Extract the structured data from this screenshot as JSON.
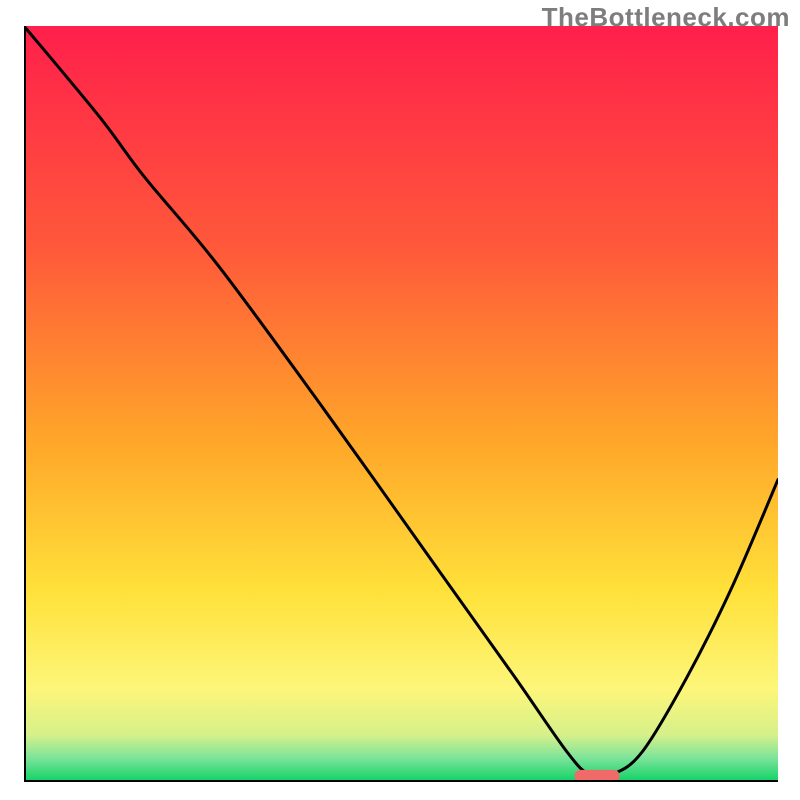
{
  "watermark": "TheBottleneck.com",
  "chart_data": {
    "type": "line",
    "title": "",
    "xlabel": "",
    "ylabel": "",
    "xlim": [
      0,
      100
    ],
    "ylim": [
      0,
      100
    ],
    "grid": false,
    "legend": false,
    "series": [
      {
        "name": "curve",
        "x": [
          0,
          10,
          16,
          26,
          40,
          55,
          65,
          72,
          75,
          78,
          82,
          88,
          94,
          100
        ],
        "y": [
          100,
          88,
          80,
          68,
          49,
          28,
          14,
          4,
          1,
          1,
          4,
          14,
          26,
          40
        ]
      }
    ],
    "marker": {
      "name": "optimum-marker",
      "x": 76,
      "y": 0.8,
      "width": 6,
      "height": 1.6,
      "color": "#f06a6a"
    },
    "gradient_stops": [
      {
        "offset": 0,
        "color": "#ff1f4b"
      },
      {
        "offset": 30,
        "color": "#ff5a3a"
      },
      {
        "offset": 55,
        "color": "#ffa629"
      },
      {
        "offset": 75,
        "color": "#ffe13a"
      },
      {
        "offset": 88,
        "color": "#fdf67a"
      },
      {
        "offset": 94,
        "color": "#d6f08a"
      },
      {
        "offset": 97,
        "color": "#7fe49a"
      },
      {
        "offset": 100,
        "color": "#17d36a"
      }
    ],
    "axis_color": "#000000",
    "axis_width": 4,
    "curve_width": 3
  }
}
